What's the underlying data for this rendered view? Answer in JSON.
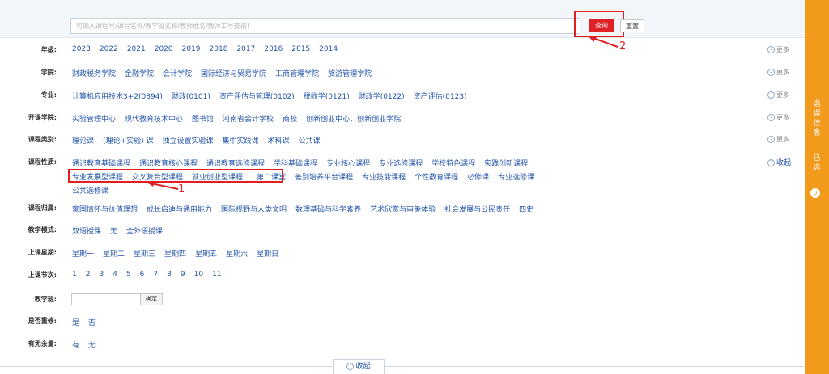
{
  "search": {
    "placeholder": "可输入课程号/课程名称/教学班名称/教师姓名/教师工号查询!",
    "query_label": "查询",
    "reset_label": "重置"
  },
  "annotations": {
    "arrow1": "1",
    "arrow2": "2"
  },
  "filters": {
    "grade": {
      "label": "年级:",
      "options": [
        "2023",
        "2022",
        "2021",
        "2020",
        "2019",
        "2018",
        "2017",
        "2016",
        "2015",
        "2014"
      ],
      "more": "更多"
    },
    "college": {
      "label": "学院:",
      "options": [
        "财政税务学院",
        "金融学院",
        "会计学院",
        "国际经济与贸易学院",
        "工商管理学院",
        "旅游管理学院"
      ],
      "more": "更多"
    },
    "major": {
      "label": "专业:",
      "options": [
        "计算机应用技术3+2(0894)",
        "财政(0101)",
        "资产评估与管理(0102)",
        "税收学(0121)",
        "财政学(0122)",
        "资产评估(0123)"
      ],
      "more": "更多"
    },
    "offering_college": {
      "label": "开课学院:",
      "options": [
        "实验管理中心",
        "现代教育技术中心",
        "图书馆",
        "河南省会计学校",
        "商校",
        "创新创业中心、创新创业学院"
      ],
      "more": "更多"
    },
    "course_type": {
      "label": "课程类别:",
      "options": [
        "理论课",
        "(理论+实验) 课",
        "独立设置实验课",
        "集中实践课",
        "术科课",
        "公共课"
      ],
      "more": "更多"
    },
    "course_nature": {
      "label": "课程性质:",
      "line1": [
        "通识教育基础课程",
        "通识教育核心课程",
        "通识教育选修课程",
        "学科基础课程",
        "专业核心课程",
        "专业选修课程",
        "学校特色课程",
        "实践创新课程"
      ],
      "line2_highlighted": [
        "专业发展型课程",
        "交叉复合型课程",
        "就业创业型课程"
      ],
      "line2_rest": [
        "第二课堂",
        "差别培养平台课程",
        "专业技能课程",
        "个性教育课程",
        "必修课",
        "专业选修课"
      ],
      "line3": [
        "公共选修课"
      ],
      "collapse": "收起"
    },
    "course_attribution": {
      "label": "课程归属:",
      "options": [
        "家国情怀与价值理想",
        "成长启迪与通用能力",
        "国际视野与人类文明",
        "数理基础与科学素养",
        "艺术欣赏与审美体验",
        "社会发展与公民责任",
        "四史"
      ]
    },
    "teaching_mode": {
      "label": "教学模式:",
      "options": [
        "双语授课",
        "无",
        "全外语授课"
      ]
    },
    "weekday": {
      "label": "上课星期:",
      "options": [
        "星期一",
        "星期二",
        "星期三",
        "星期四",
        "星期五",
        "星期六",
        "星期日"
      ]
    },
    "period": {
      "label": "上课节次:",
      "options": [
        "1",
        "2",
        "3",
        "4",
        "5",
        "6",
        "7",
        "8",
        "9",
        "10",
        "11"
      ]
    },
    "teaching_class": {
      "label": "教学班:",
      "confirm": "确定"
    },
    "retake": {
      "label": "是否重修:",
      "options": [
        "是",
        "否"
      ]
    },
    "remaining": {
      "label": "有无余量:",
      "options": [
        "有",
        "无"
      ]
    }
  },
  "bottom_collapse": "收起",
  "sidebar": {
    "course_info": "选课信息",
    "selected": "已选",
    "selected_count": "0"
  },
  "colors": {
    "accent_red": "#e01f26",
    "link_blue": "#2255aa",
    "sidebar_orange": "#f29a1c"
  }
}
